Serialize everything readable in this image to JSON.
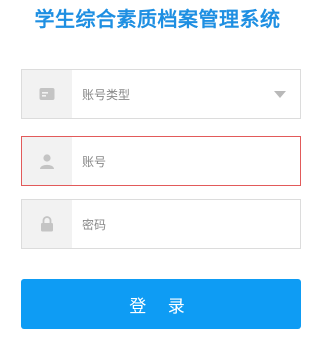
{
  "header": {
    "title": "学生综合素质档案管理系统"
  },
  "form": {
    "account_type": {
      "selected": "账号类型",
      "icon": "id-card-icon"
    },
    "account": {
      "placeholder": "账号",
      "icon": "user-icon",
      "state": "error"
    },
    "password": {
      "placeholder": "密码",
      "icon": "lock-icon"
    },
    "login_label": "登 录"
  },
  "colors": {
    "accent": "#1e8fe2",
    "button": "#0e9cf4",
    "error_border": "#e25a5a",
    "icon": "#c4c4c4"
  }
}
